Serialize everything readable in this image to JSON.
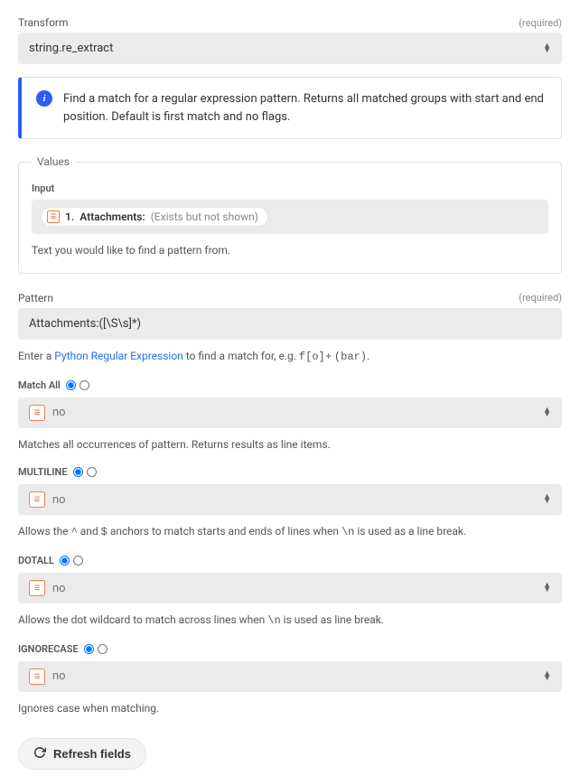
{
  "transform": {
    "label": "Transform",
    "required": "(required)",
    "value": "string.re_extract"
  },
  "info": {
    "text": "Find a match for a regular expression pattern. Returns all matched groups with start and end position. Default is first match and no flags."
  },
  "values": {
    "legend": "Values",
    "input_label": "Input",
    "pill_number": "1.",
    "pill_label": "Attachments:",
    "pill_extra": "(Exists but not shown)",
    "help": "Text you would like to find a pattern from."
  },
  "pattern": {
    "label": "Pattern",
    "required": "(required)",
    "value": "Attachments:([\\S\\s]*)",
    "help_prefix": "Enter a ",
    "help_link": "Python Regular Expression",
    "help_mid": " to find a match for, e.g. ",
    "help_code1": "f[o]+",
    "help_code2": "(bar)",
    "help_end": "."
  },
  "matchAll": {
    "label": "Match All",
    "value": "no",
    "help": "Matches all occurrences of pattern. Returns results as line items."
  },
  "multiline": {
    "label": "MULTILINE",
    "value": "no",
    "help_p1": "Allows the ",
    "help_c1": "^",
    "help_p2": " and ",
    "help_c2": "$",
    "help_p3": " anchors to match starts and ends of lines when ",
    "help_c3": "\\n",
    "help_p4": " is used as a line break."
  },
  "dotall": {
    "label": "DOTALL",
    "value": "no",
    "help_p1": "Allows the dot wildcard to match across lines when ",
    "help_c1": "\\n",
    "help_p2": " is used as line break."
  },
  "ignorecase": {
    "label": "IGNORECASE",
    "value": "no",
    "help": "Ignores case when matching."
  },
  "refresh": {
    "label": "Refresh fields"
  }
}
